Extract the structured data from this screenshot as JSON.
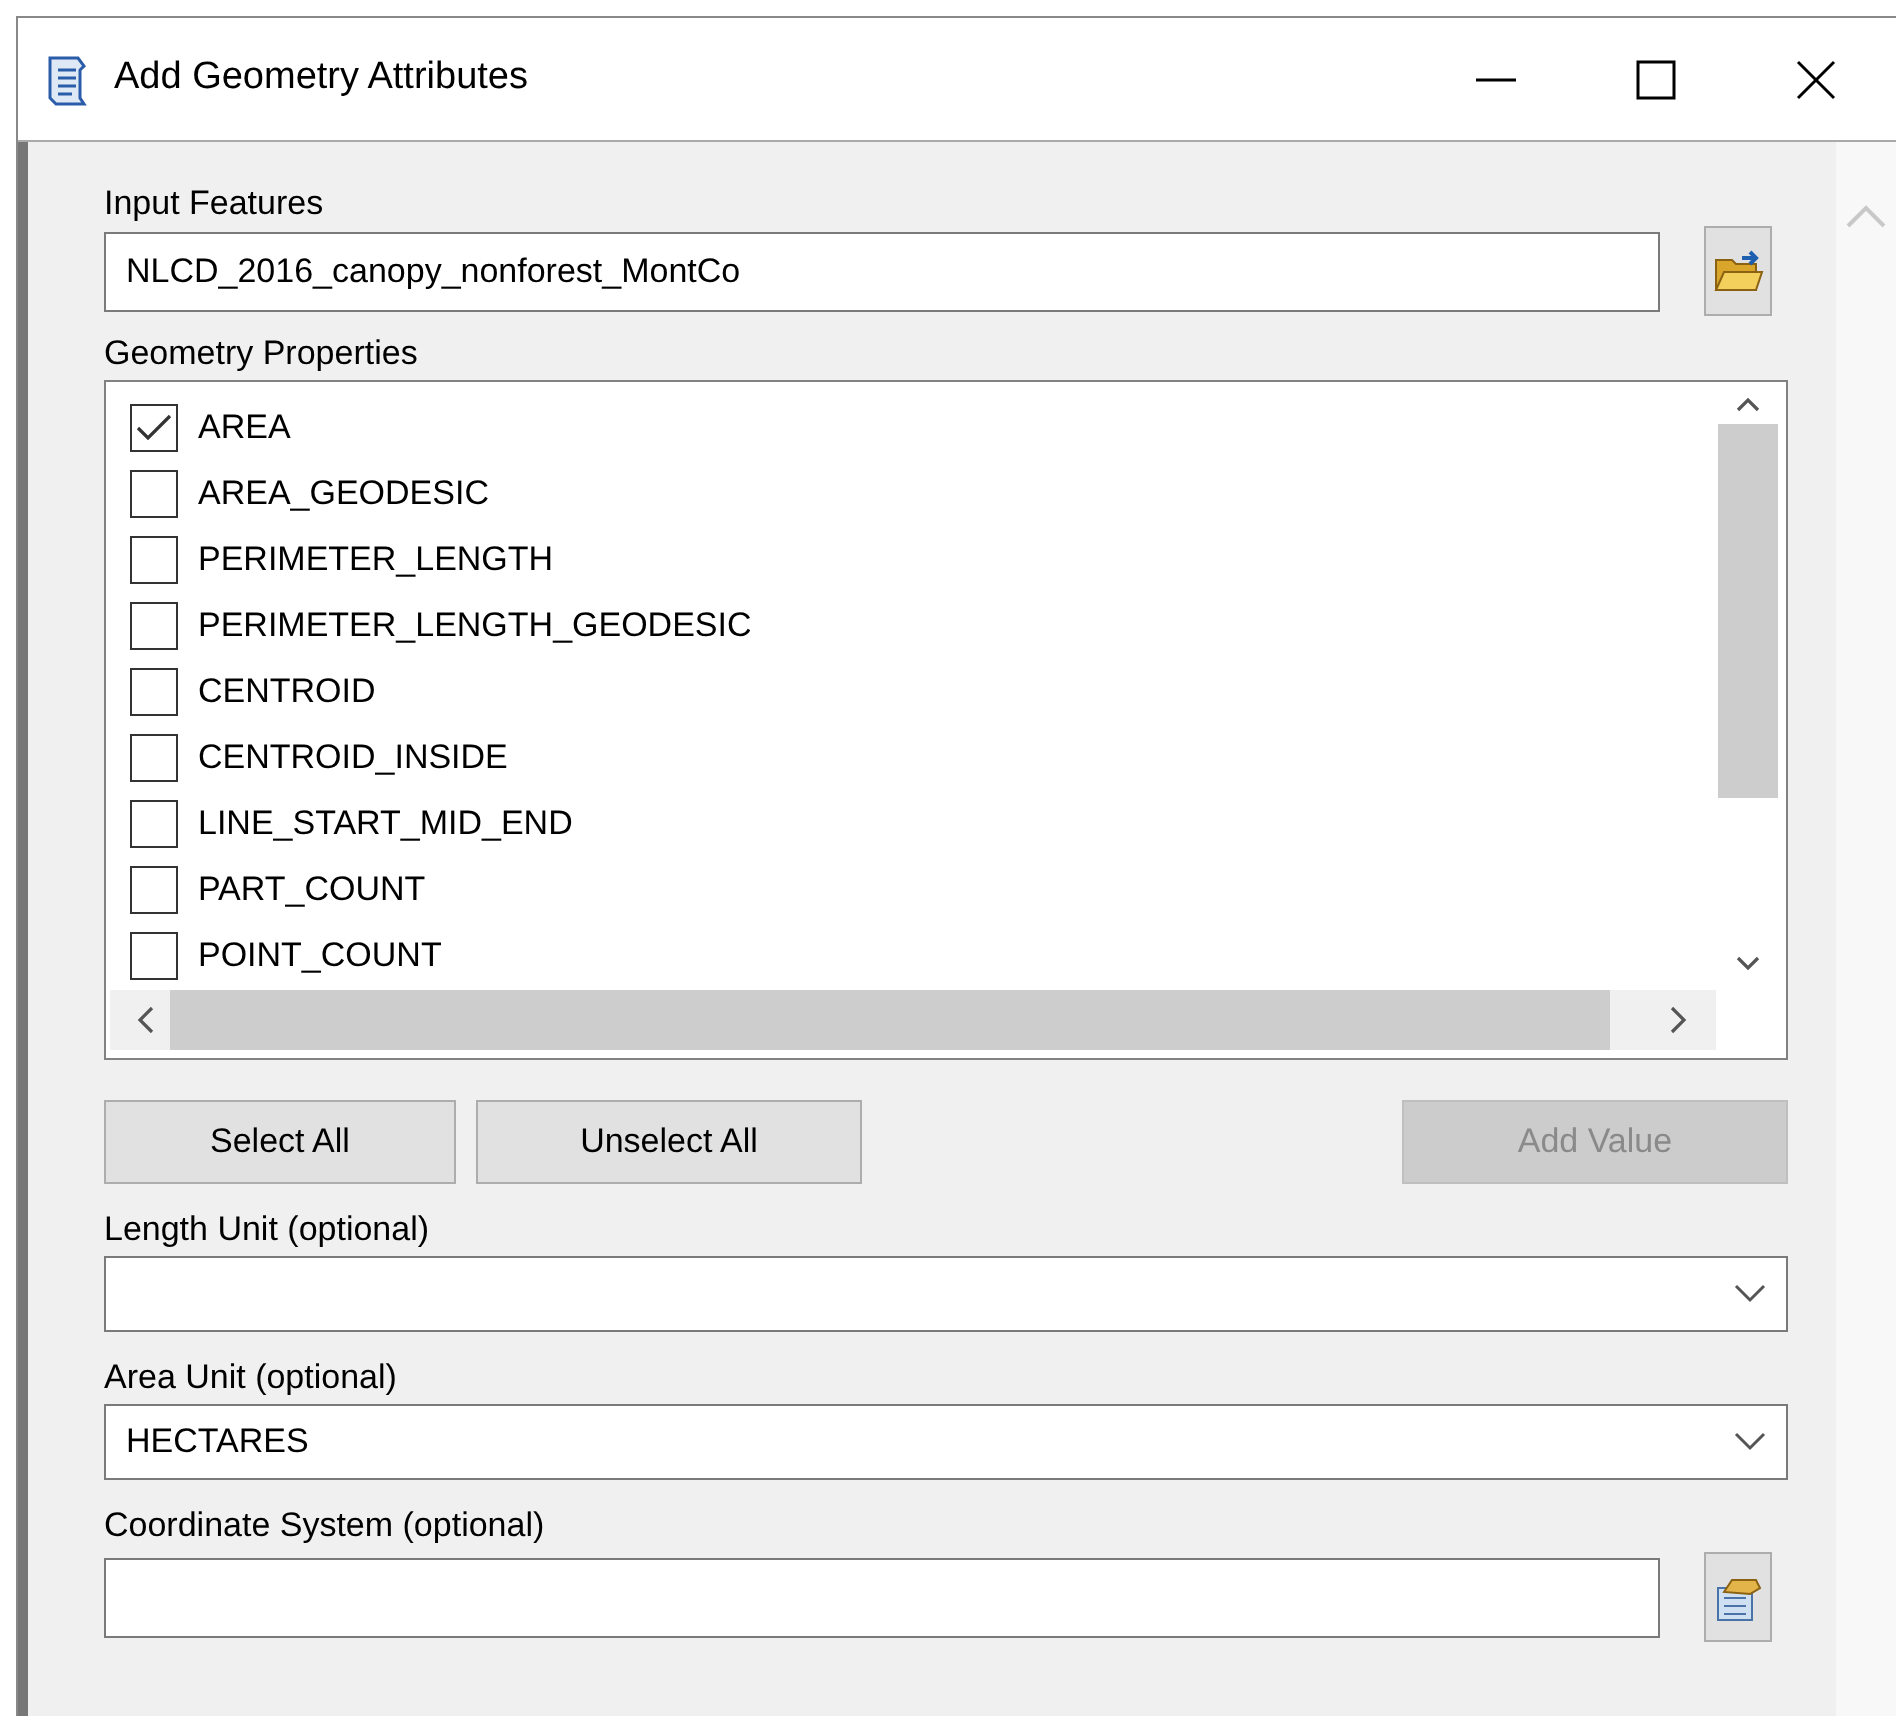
{
  "window": {
    "title": "Add Geometry Attributes"
  },
  "input_features": {
    "label": "Input Features",
    "value": "NLCD_2016_canopy_nonforest_MontCo"
  },
  "geometry_properties": {
    "label": "Geometry Properties",
    "items": [
      {
        "label": "AREA",
        "checked": true
      },
      {
        "label": "AREA_GEODESIC",
        "checked": false
      },
      {
        "label": "PERIMETER_LENGTH",
        "checked": false
      },
      {
        "label": "PERIMETER_LENGTH_GEODESIC",
        "checked": false
      },
      {
        "label": "CENTROID",
        "checked": false
      },
      {
        "label": "CENTROID_INSIDE",
        "checked": false
      },
      {
        "label": "LINE_START_MID_END",
        "checked": false
      },
      {
        "label": "PART_COUNT",
        "checked": false
      },
      {
        "label": "POINT_COUNT",
        "checked": false
      }
    ]
  },
  "buttons": [
    {
      "label": "Select All",
      "disabled": false
    },
    {
      "label": "Unselect All",
      "disabled": false
    },
    {
      "label": "Add Value",
      "disabled": true
    }
  ],
  "length_unit": {
    "label": "Length Unit (optional)"
  },
  "area_unit": {
    "label": "Area Unit (optional)",
    "value": "HECTARES"
  },
  "coordinate_system": {
    "label": "Coordinate System (optional)"
  }
}
